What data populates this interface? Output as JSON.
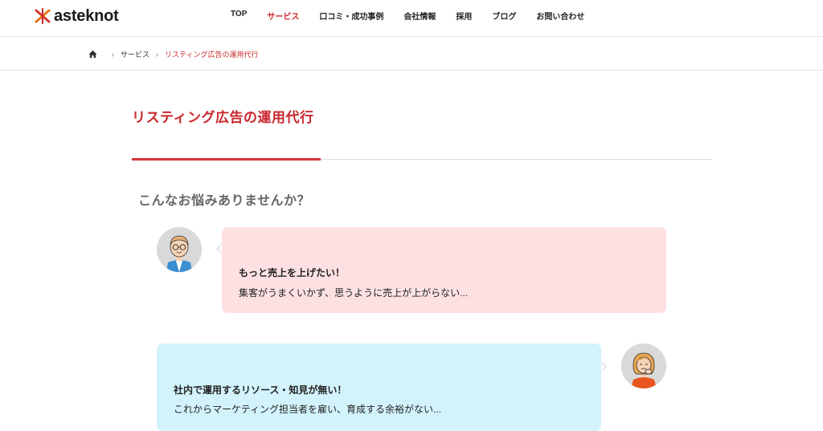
{
  "header": {
    "logo_text": "asteknot",
    "nav": [
      "TOP",
      "サービス",
      "口コミ・成功事例",
      "会社情報",
      "採用",
      "ブログ",
      "お問い合わせ"
    ],
    "active_index": 1
  },
  "breadcrumb": {
    "items": [
      "サービス",
      "リスティング広告の運用代行"
    ]
  },
  "page": {
    "title": "リスティング広告の運用代行",
    "section_heading": "こんなお悩みありませんか？"
  },
  "worries": [
    {
      "title": "もっと売上を上げたい！",
      "text": "集客がうまくいかず、思うように売上が上がらない..."
    },
    {
      "title": "社内で運用するリソース・知見が無い！",
      "text": "これからマーケティング担当者を雇い、育成する余裕がない..."
    }
  ],
  "colors": {
    "accent": "#c9282d",
    "bubble_pink": "#fde1e2",
    "bubble_blue": "#d2f3fc"
  }
}
